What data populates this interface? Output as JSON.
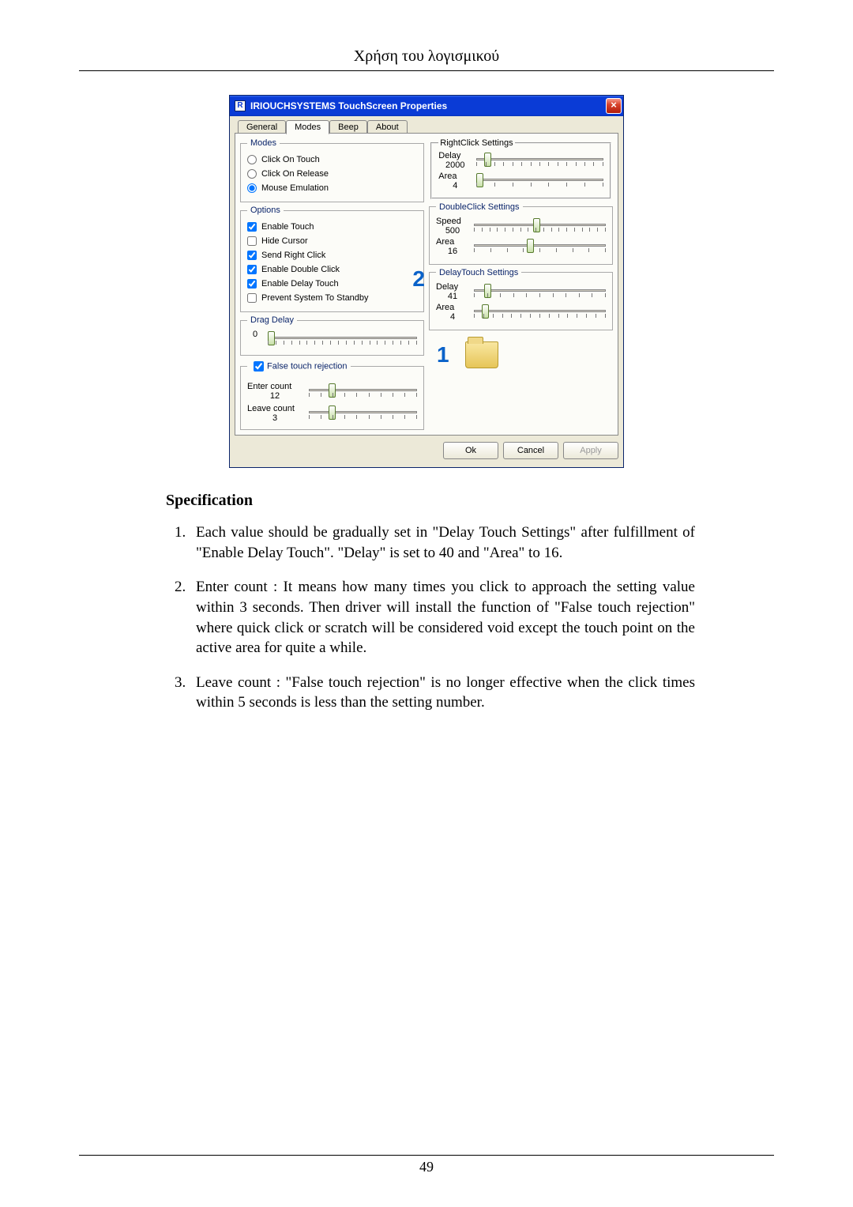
{
  "header": {
    "title": "Χρήση του λογισμικού"
  },
  "dialog": {
    "window_title": "IRIOUCHSYSTEMS TouchScreen Properties",
    "close_glyph": "×",
    "app_icon_text": "R",
    "tabs": [
      "General",
      "Modes",
      "Beep",
      "About"
    ],
    "active_tab_index": 1,
    "groups": {
      "modes": {
        "legend": "Modes",
        "items": [
          {
            "label": "Click On Touch",
            "checked": false
          },
          {
            "label": "Click On Release",
            "checked": false
          },
          {
            "label": "Mouse Emulation",
            "checked": true
          }
        ]
      },
      "options": {
        "legend": "Options",
        "items": [
          {
            "label": "Enable Touch",
            "checked": true
          },
          {
            "label": "Hide Cursor",
            "checked": false
          },
          {
            "label": "Send Right Click",
            "checked": true
          },
          {
            "label": "Enable Double Click",
            "checked": true
          },
          {
            "label": "Enable Delay Touch",
            "checked": true
          },
          {
            "label": "Prevent System To Standby",
            "checked": false
          }
        ]
      },
      "drag_delay": {
        "legend": "Drag Delay",
        "value": "0"
      },
      "false_touch": {
        "legend": "False touch rejection",
        "checked": true,
        "enter_label": "Enter count",
        "enter_value": "12",
        "leave_label": "Leave count",
        "leave_value": "3"
      },
      "rightclick": {
        "legend": "RightClick Settings",
        "delay_label": "Delay",
        "delay_value": "2000",
        "area_label": "Area",
        "area_value": "4"
      },
      "doubleclick": {
        "legend": "DoubleClick Settings",
        "speed_label": "Speed",
        "speed_value": "500",
        "area_label": "Area",
        "area_value": "16"
      },
      "delaytouch": {
        "legend": "DelayTouch Settings",
        "delay_label": "Delay",
        "delay_value": "41",
        "area_label": "Area",
        "area_value": "4"
      }
    },
    "buttons": {
      "ok": "Ok",
      "cancel": "Cancel",
      "apply": "Apply"
    },
    "annotations": {
      "one": "1",
      "two": "2"
    }
  },
  "spec": {
    "heading": "Specification",
    "items": [
      "Each value should be gradually set in \"Delay Touch Settings\" after fulfillment of \"Enable Delay Touch\". \"Delay\" is set to 40 and \"Area\" to 16.",
      "Enter count : It means how many times you click to approach the setting value within 3 seconds. Then driver will install the function of \"False touch rejection\" where quick click or scratch will be considered void except the touch point on the active area for quite a while.",
      "Leave count : \"False touch rejection\" is no longer effective when the click times within 5 seconds is less than the setting number."
    ]
  },
  "footer": {
    "page_number": "49"
  }
}
